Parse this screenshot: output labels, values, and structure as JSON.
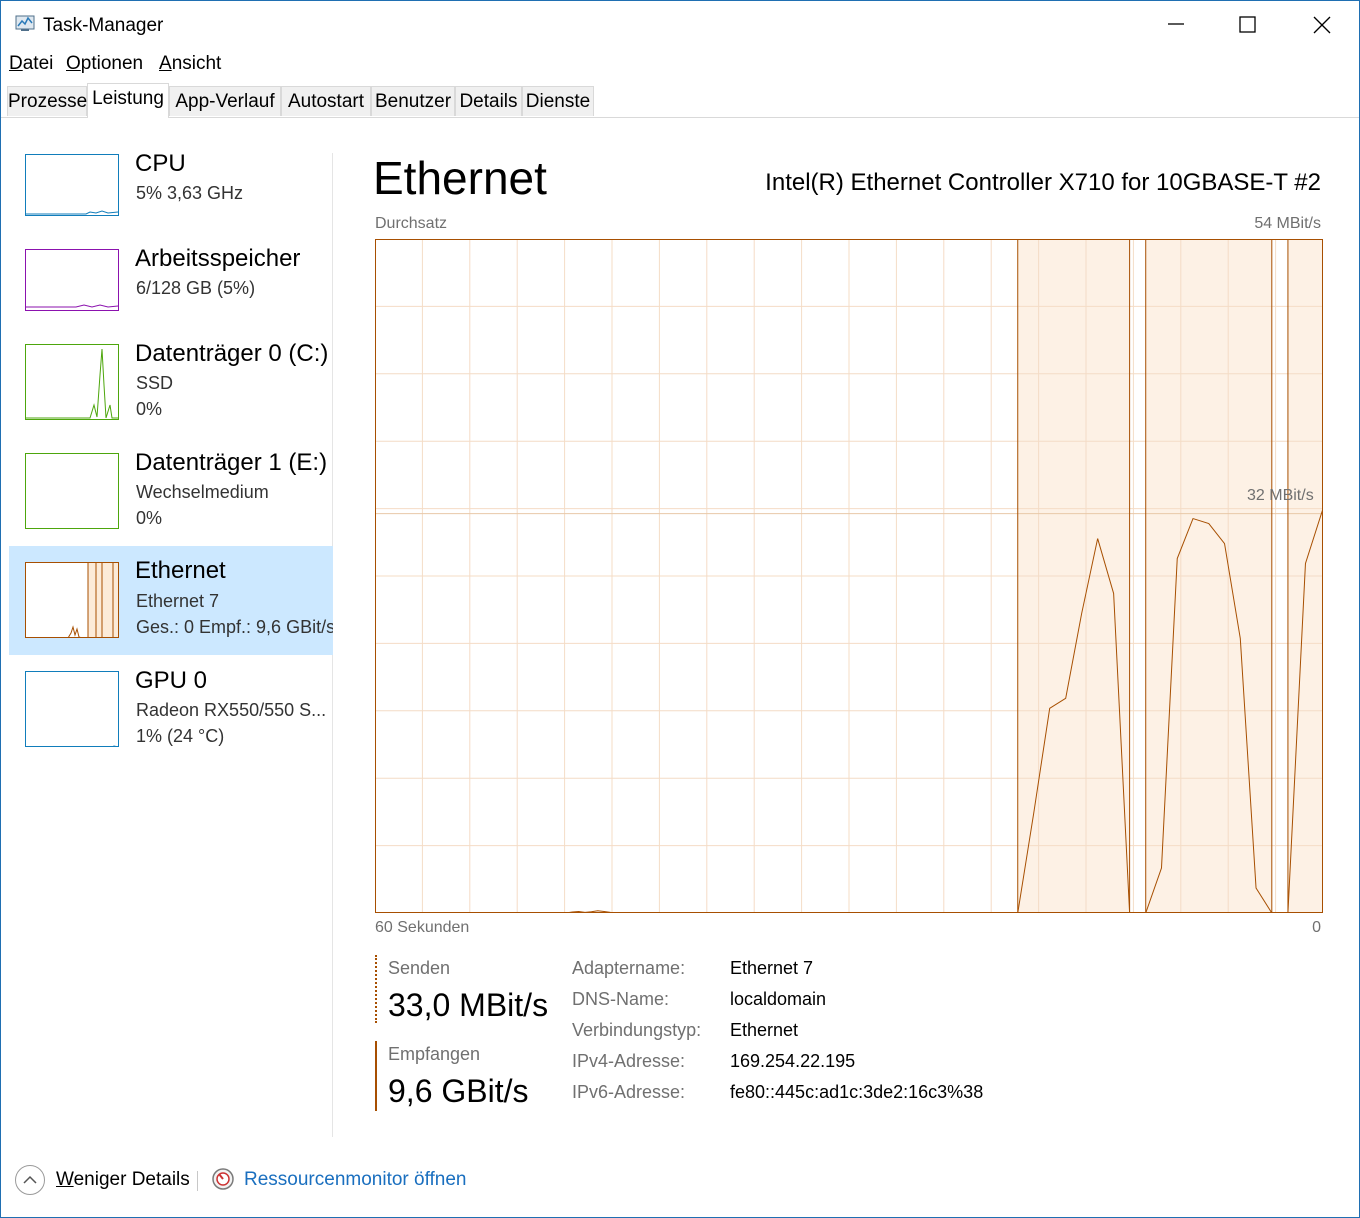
{
  "window": {
    "title": "Task-Manager",
    "controls": [
      "minimize-icon",
      "maximize-icon",
      "close-icon"
    ]
  },
  "menu": [
    {
      "first": "D",
      "rest": "atei"
    },
    {
      "first": "O",
      "rest": "ptionen"
    },
    {
      "first": "A",
      "rest": "nsicht"
    }
  ],
  "tabs": [
    "Prozesse",
    "Leistung",
    "App-Verlauf",
    "Autostart",
    "Benutzer",
    "Details",
    "Dienste"
  ],
  "active_tab": "Leistung",
  "sidebar": [
    {
      "title": "CPU",
      "lines": [
        "5%  3,63 GHz"
      ],
      "color": "#117dbb"
    },
    {
      "title": "Arbeitsspeicher",
      "lines": [
        "6/128 GB (5%)"
      ],
      "color": "#8b12ae"
    },
    {
      "title": "Datenträger 0 (C:)",
      "lines": [
        "SSD",
        "0%"
      ],
      "color": "#4da60c"
    },
    {
      "title": "Datenträger 1 (E:)",
      "lines": [
        "Wechselmedium",
        "0%"
      ],
      "color": "#4da60c"
    },
    {
      "title": "Ethernet",
      "lines": [
        "Ethernet 7",
        "Ges.: 0  Empf.: 9,6 GBit/s"
      ],
      "color": "#a74f01",
      "selected": true
    },
    {
      "title": "GPU 0",
      "lines": [
        "Radeon RX550/550 S...",
        "1%  (24 °C)"
      ],
      "color": "#117dbb"
    }
  ],
  "main": {
    "title": "Ethernet",
    "adapter": "Intel(R) Ethernet Controller X710 for 10GBASE-T #2",
    "chart_label": "Durchsatz",
    "scale_max": "54 MBit/s",
    "scale_mid": "32 MBit/s",
    "time_label": "60 Sekunden",
    "time_end": "0",
    "accent_color": "#a74f01"
  },
  "chart_data": {
    "type": "line",
    "ylim": [
      0,
      54
    ],
    "send_series_mbit": [
      0,
      0,
      0,
      0,
      0,
      0,
      0,
      0,
      0,
      0,
      0,
      0,
      0,
      0,
      0,
      0,
      0,
      0,
      0,
      0,
      0,
      0,
      0,
      0,
      0,
      0,
      0,
      0,
      0,
      0,
      0,
      0.08,
      0.12,
      0.05,
      0.1,
      0.18,
      0.12,
      0.05,
      0,
      0,
      0,
      0,
      0,
      0,
      0,
      0,
      0,
      0,
      0,
      0,
      0,
      0,
      0,
      0,
      0,
      0,
      0,
      0,
      0,
      0,
      0,
      0,
      0,
      0,
      0,
      0,
      0,
      0,
      0,
      0,
      0,
      0,
      0,
      0,
      0,
      0,
      0,
      0,
      0,
      0,
      0,
      0,
      0,
      0,
      0,
      0,
      0,
      0,
      0,
      0,
      0,
      0,
      0,
      0,
      0,
      0,
      0,
      0,
      0,
      0,
      0,
      0
    ],
    "send_series_peaks": [
      {
        "from": 0.678,
        "to": 0.796,
        "values": [
          0,
          8,
          16.4,
          17.2,
          24,
          30,
          25.6,
          0
        ]
      },
      {
        "from": 0.813,
        "to": 0.946,
        "values": [
          0,
          3.6,
          28.4,
          31.6,
          31.2,
          29.6,
          22,
          2,
          0
        ]
      },
      {
        "from": 0.963,
        "to": 1.0,
        "values": [
          0,
          28,
          32.4
        ]
      }
    ],
    "saturated_spans": [
      [
        0.678,
        0.796
      ],
      [
        0.813,
        0.946
      ],
      [
        0.963,
        1.0
      ]
    ]
  },
  "stats": {
    "send_label": "Senden",
    "send_value": "33,0 MBit/s",
    "recv_label": "Empfangen",
    "recv_value": "9,6 GBit/s"
  },
  "properties": [
    {
      "label": "Adaptername:",
      "value": "Ethernet 7"
    },
    {
      "label": "DNS-Name:",
      "value": "localdomain"
    },
    {
      "label": "Verbindungstyp:",
      "value": "Ethernet"
    },
    {
      "label": "IPv4-Adresse:",
      "value": "169.254.22.195"
    },
    {
      "label": "IPv6-Adresse:",
      "value": "fe80::445c:ad1c:3de2:16c3%38"
    }
  ],
  "footer": {
    "less_first": "W",
    "less_rest": "eniger Details",
    "resource_monitor": "Ressourcenmonitor öffnen"
  }
}
